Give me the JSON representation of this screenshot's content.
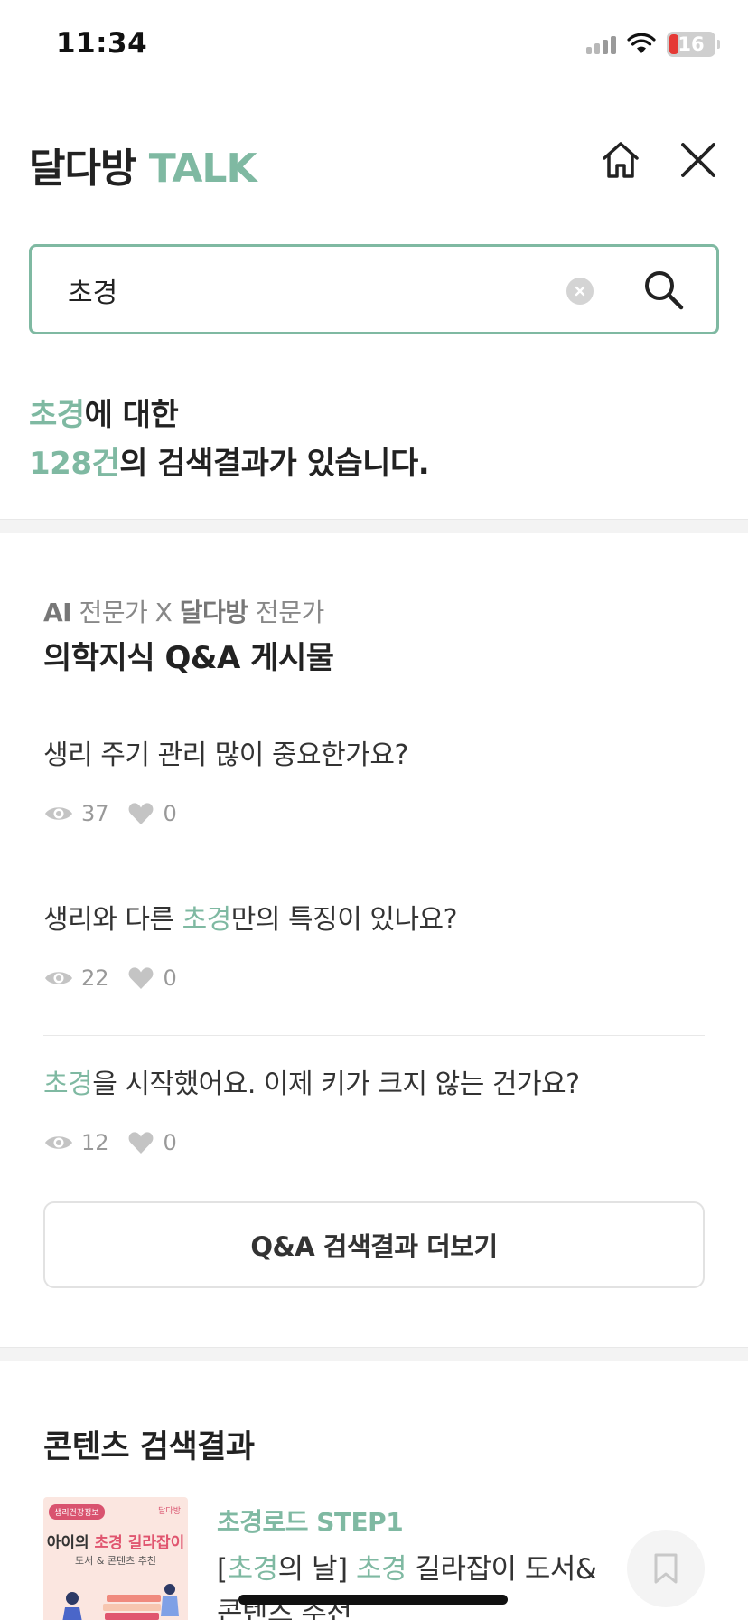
{
  "status_bar": {
    "time": "11:34",
    "battery_level": "16"
  },
  "header": {
    "brand_main": "달다방",
    "brand_accent": "TALK"
  },
  "search": {
    "query": "초경",
    "placeholder": ""
  },
  "summary": {
    "keyword": "초경",
    "line1_suffix": "에 대한",
    "count": "128건",
    "line2_suffix": "의 검색결과가 있습니다."
  },
  "qa_section": {
    "subtitle_ai": "AI",
    "subtitle_mid": "전문가 X",
    "subtitle_brand": "달다방",
    "subtitle_end": "전문가",
    "title": "의학지식 Q&A 게시물",
    "items": [
      {
        "q_pre": "생리 주기 관리 많이 중요한가요?",
        "q_hl": "",
        "q_post": "",
        "views": "37",
        "likes": "0"
      },
      {
        "q_pre": "생리와 다른 ",
        "q_hl": "초경",
        "q_post": "만의 특징이 있나요?",
        "views": "22",
        "likes": "0"
      },
      {
        "q_pre": "",
        "q_hl": "초경",
        "q_post": "을 시작했어요. 이제 키가 크지 않는 건가요?",
        "views": "12",
        "likes": "0"
      }
    ],
    "more_label": "Q&A 검색결과 더보기"
  },
  "content_section": {
    "title": "콘텐츠 검색결과",
    "cards": [
      {
        "category": "초경로드 STEP1",
        "title_parts": [
          "[",
          "초경",
          "의 날] ",
          "초경",
          " 길라잡이 도서&콘텐츠 추천"
        ],
        "thumb_tag": "생리건강정보",
        "thumb_brand": "달다방",
        "thumb_line1_pre": "아이의 ",
        "thumb_line1_hl": "초경 길라잡이",
        "thumb_line2": "도서 & 콘텐츠 추천"
      }
    ]
  },
  "colors": {
    "accent": "#7fb9a2",
    "text": "#222222",
    "muted": "#999999"
  }
}
